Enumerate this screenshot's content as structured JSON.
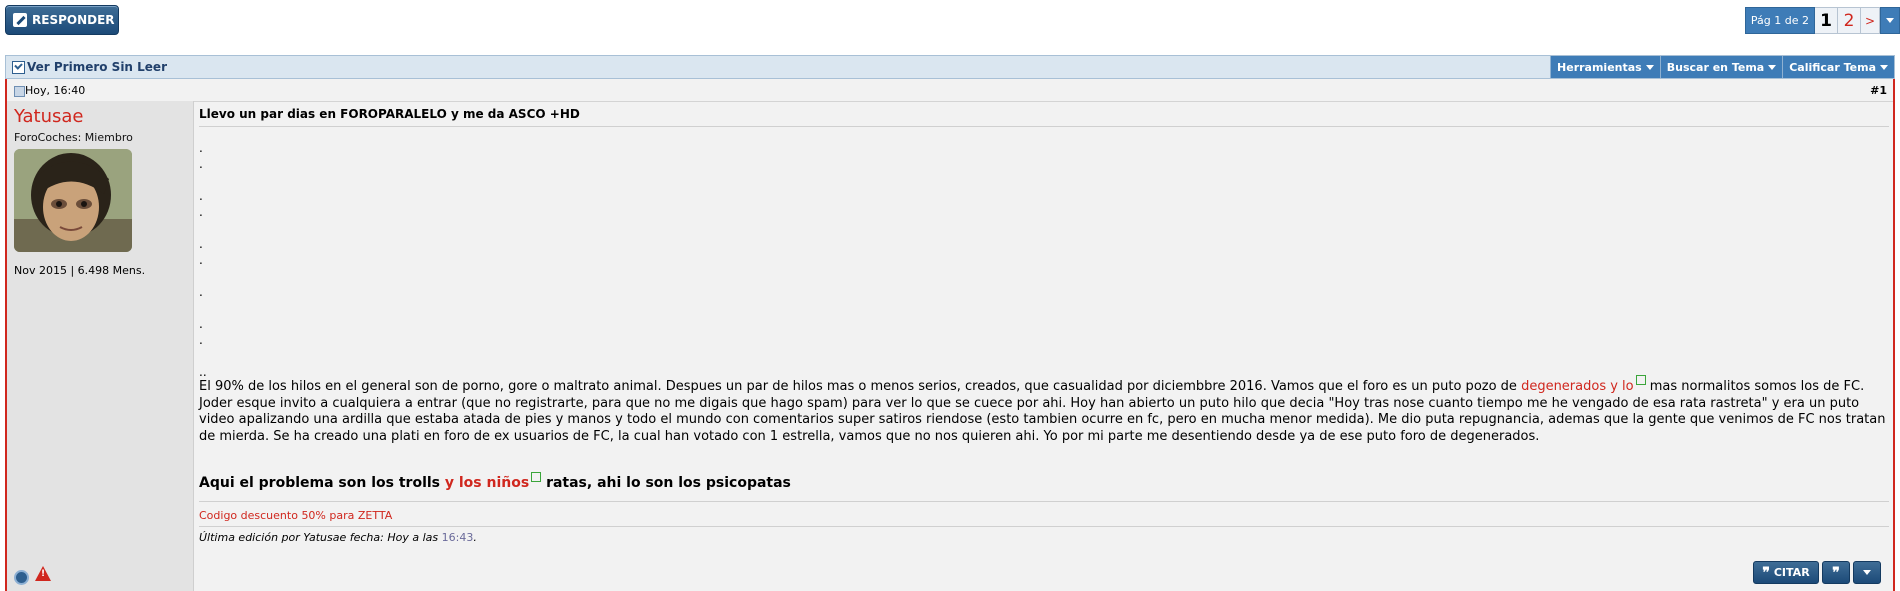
{
  "toolbar": {
    "reply_label": "RESPONDER"
  },
  "pagination": {
    "label": "Pág 1 de 2",
    "current": "1",
    "next_page": "2",
    "next_arrow": ">"
  },
  "threadbar": {
    "title": "Ver Primero Sin Leer",
    "menus": [
      "Herramientas",
      "Buscar en Tema",
      "Calificar Tema"
    ]
  },
  "post": {
    "date": "Hoy, 16:40",
    "number": "#1",
    "username": "Yatusae",
    "usertitle": "ForoCoches: Miembro",
    "userstats": "Nov 2015 | 6.498 Mens.",
    "title": "Llevo un par dias en FOROPARALELO y me da ASCO +HD",
    "dots": [
      ".",
      ".",
      ".",
      ".",
      ".",
      ".",
      ".",
      ".",
      ".",
      ".."
    ],
    "body_p1": "El 90% de los hilos en el general son de porno, gore o maltrato animal. Despues un par de hilos mas o menos serios, creados, que casualidad por diciembbre 2016. Vamos que el foro es un puto pozo de ",
    "body_link1": "degenerados y lo",
    "body_p2": " mas normalitos somos los de FC. Joder esque invito a cualquiera a entrar (que no registrarte, para que no me digais que hago spam) para ver lo que se cuece por ahi. Hoy han abierto un puto hilo que decia \"Hoy tras nose cuanto tiempo me he vengado de esa rata rastreta\" y era un puto video apalizando una ardilla que estaba atada de pies y manos y todo el mundo con comentarios super satiros riendose (esto tambien ocurre en fc, pero en mucha menor medida). Me dio puta repugnancia, ademas que la gente que venimos de FC nos tratan de mierda. Se ha creado una plati en foro de ex usuarios de FC, la cual han votado con 1 estrella, vamos que no nos quieren ahi. Yo por mi parte me desentiendo desde ya de ese puto foro de degenerados.",
    "big_text1": "Aqui el problema son los trolls",
    "big_link": " y los niños",
    "big_text2": "ratas, ahi lo son los psicopatas",
    "signature": "Codigo descuento 50% para ZETTA",
    "edit_prefix": "Última edición por Yatusae fecha: Hoy a las ",
    "edit_time": "16:43",
    "edit_suffix": ".",
    "quote_label": "CITAR"
  }
}
